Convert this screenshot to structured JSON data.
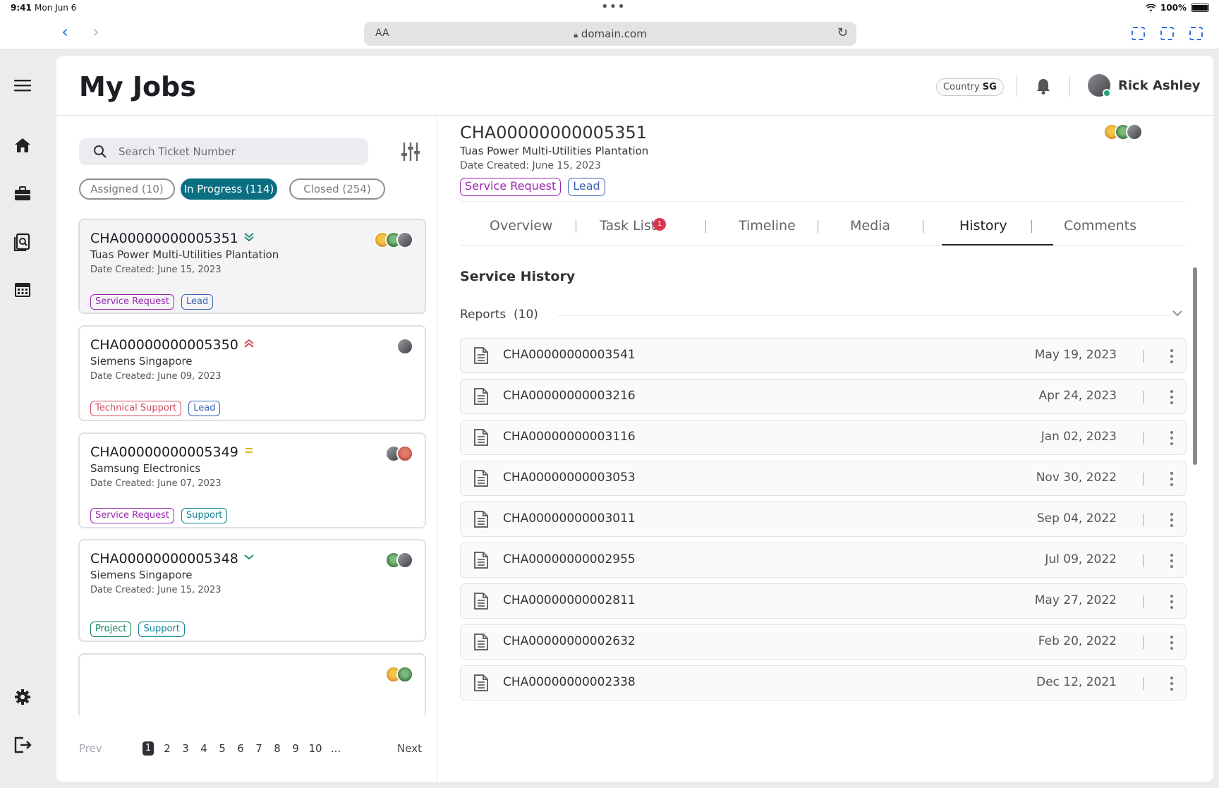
{
  "status": {
    "time": "9:41",
    "date": "Mon Jun 6",
    "battery": "100%"
  },
  "browser": {
    "text_size": "AA",
    "url": "domain.com"
  },
  "header": {
    "title": "My Jobs",
    "country_label": "Country",
    "country_code": "SG",
    "user_name": "Rick Ashley"
  },
  "search": {
    "placeholder": "Search Ticket Number"
  },
  "filters": [
    {
      "label": "Assigned (10)",
      "active": false
    },
    {
      "label": "In Progress (114)",
      "active": true
    },
    {
      "label": "Closed (254)",
      "active": false
    }
  ],
  "jobs": [
    {
      "id": "CHA00000000005351",
      "company": "Tuas Power Multi-Utilities Plantation",
      "date": "Date Created: June 15, 2023",
      "priority_icon": "double-chevron-down-icon",
      "tags": [
        "Service Request",
        "Lead"
      ]
    },
    {
      "id": "CHA00000000005350",
      "company": "Siemens Singapore",
      "date": "Date Created: June 09, 2023",
      "priority_icon": "double-chevron-up-icon",
      "tags": [
        "Technical Support",
        "Lead"
      ]
    },
    {
      "id": "CHA00000000005349",
      "company": "Samsung Electronics",
      "date": "Date Created: June 07, 2023",
      "priority_icon": "equals-icon",
      "tags": [
        "Service Request",
        "Support"
      ]
    },
    {
      "id": "CHA00000000005348",
      "company": "Siemens Singapore",
      "date": "Date Created: June 15, 2023",
      "priority_icon": "chevron-down-icon",
      "tags": [
        "Project",
        "Support"
      ]
    }
  ],
  "pagination": {
    "prev": "Prev",
    "next": "Next",
    "pages": [
      "1",
      "2",
      "3",
      "4",
      "5",
      "6",
      "7",
      "8",
      "9",
      "10",
      "..."
    ],
    "current": "1"
  },
  "detail": {
    "id": "CHA00000000005351",
    "company": "Tuas Power Multi-Utilities Plantation",
    "date": "Date Created: June 15, 2023",
    "tags": [
      "Service Request",
      "Lead"
    ],
    "tabs": [
      "Overview",
      "Task List",
      "Timeline",
      "Media",
      "History",
      "Comments"
    ],
    "active_tab": "History",
    "task_list_badge": "1",
    "section_title": "Service History",
    "reports_label": "Reports",
    "reports_count": "(10)",
    "reports": [
      {
        "id": "CHA00000000003541",
        "date": "May 19, 2023"
      },
      {
        "id": "CHA00000000003216",
        "date": "Apr 24, 2023"
      },
      {
        "id": "CHA00000000003116",
        "date": "Jan 02, 2023"
      },
      {
        "id": "CHA00000000003053",
        "date": "Nov 30, 2022"
      },
      {
        "id": "CHA00000000003011",
        "date": "Sep 04, 2022"
      },
      {
        "id": "CHA00000000002955",
        "date": "Jul 09, 2022"
      },
      {
        "id": "CHA00000000002811",
        "date": "May 27, 2022"
      },
      {
        "id": "CHA00000000002632",
        "date": "Feb 20, 2022"
      },
      {
        "id": "CHA00000000002338",
        "date": "Dec 12, 2021"
      }
    ]
  },
  "colors": {
    "accent": "#0b6f82",
    "service_request": "#9b27b0",
    "lead": "#3b62b3",
    "technical_support": "#d2495a",
    "support": "#0f8596",
    "project": "#0c7d5c",
    "badge": "#d9364d"
  }
}
